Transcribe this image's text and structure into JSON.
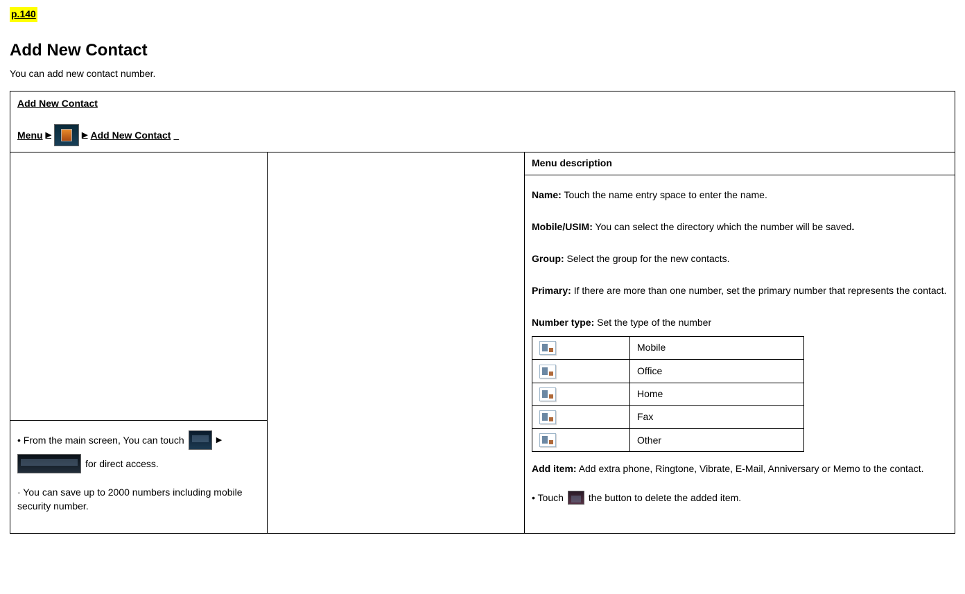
{
  "page_number": "p.140",
  "title": "Add New Contact",
  "intro": "You can add new contact number.",
  "header": {
    "title": "Add New Contact",
    "menu_label": "Menu",
    "nav_tail": "Add New Contact"
  },
  "notes": {
    "line1_a": "• From the main screen, You can touch",
    "line1_b": "for direct access.",
    "line2": "·  You can save up to 2000 numbers including mobile security number."
  },
  "desc": {
    "header": "Menu description",
    "name_label": "Name:",
    "name_text": "Touch the name entry space to enter the name.",
    "mobile_label": "Mobile/USIM:",
    "mobile_text": "You can select the directory which the number will be saved",
    "trail_dot": ".",
    "group_label": "Group:",
    "group_text": "Select the group for the new contacts.",
    "primary_label": "Primary:",
    "primary_text": "If there are more than one number, set the primary number that represents the contact.",
    "numtype_label": "Number type:",
    "numtype_text": "Set the type of the number",
    "types": {
      "0": "Mobile",
      "1": "Office",
      "2": "Home",
      "3": "Fax",
      "4": "Other"
    },
    "additem_label": "Add item:",
    "additem_text": "Add extra phone, Ringtone, Vibrate, E-Mail, Anniversary or Memo to the contact.",
    "touch_a": "•  Touch",
    "touch_b": "the button to delete the added item."
  }
}
